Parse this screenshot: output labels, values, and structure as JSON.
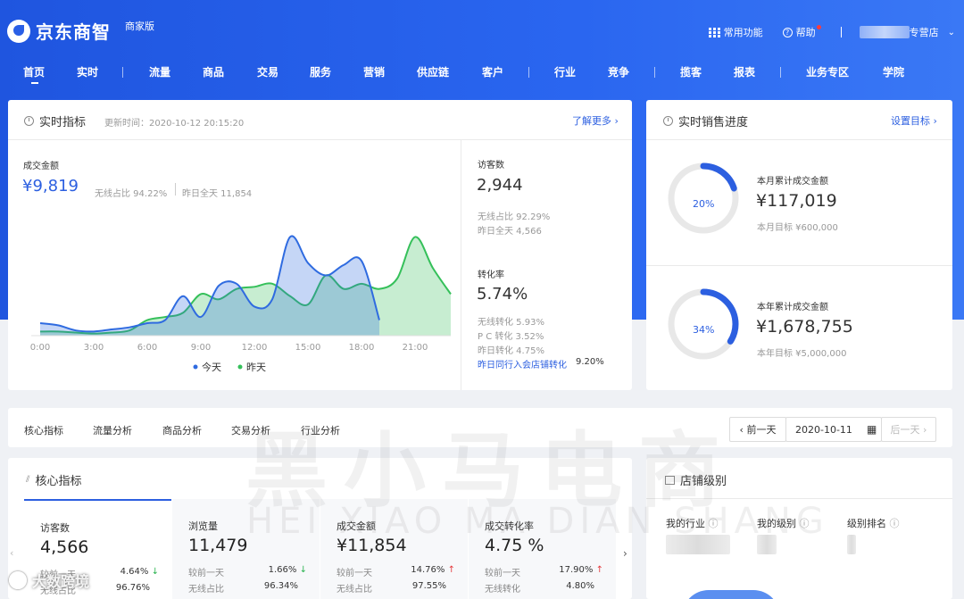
{
  "header": {
    "logo_text": "京东商智",
    "logo_sub": "商家版",
    "common_functions": "常用功能",
    "help": "帮助",
    "store_suffix": "专营店"
  },
  "nav": {
    "items": [
      "首页",
      "实时",
      "流量",
      "商品",
      "交易",
      "服务",
      "营销",
      "供应链",
      "客户",
      "行业",
      "竞争",
      "揽客",
      "报表",
      "业务专区",
      "学院"
    ]
  },
  "realtime": {
    "title": "实时指标",
    "update_time": "更新时间：2020-10-12 20:15:20",
    "learn_more": "了解更多 ›",
    "gmv_label": "成交金额",
    "gmv_value": "¥9,819",
    "wireless_share": "无线占比  94.22%",
    "yesterday_full": "昨日全天  11,854",
    "visitors_label": "访客数",
    "visitors_value": "2,944",
    "visitors_wireless": "无线占比    92.29%",
    "visitors_yesterday": "昨日全天    4,566",
    "conv_label": "转化率",
    "conv_value": "5.74%",
    "conv_wireless": "无线转化    5.93%",
    "conv_pc": "P C 转化    3.52%",
    "conv_yesterday": "昨日转化    4.75%",
    "conv_industry": "昨日同行入会店铺转化",
    "conv_industry_value": "9.20%",
    "legend_today": "今天",
    "legend_yesterday": "昨天"
  },
  "chart_data": {
    "type": "area",
    "x": [
      "0:00",
      "1:00",
      "2:00",
      "3:00",
      "4:00",
      "5:00",
      "6:00",
      "7:00",
      "8:00",
      "9:00",
      "10:00",
      "11:00",
      "12:00",
      "13:00",
      "14:00",
      "15:00",
      "16:00",
      "17:00",
      "18:00",
      "19:00",
      "20:00",
      "21:00",
      "22:00",
      "23:00"
    ],
    "x_ticks": [
      "0:00",
      "3:00",
      "6:00",
      "9:00",
      "12:00",
      "15:00",
      "18:00",
      "21:00"
    ],
    "series": [
      {
        "name": "今天",
        "color": "#2f6be0",
        "values": [
          12,
          10,
          5,
          4,
          6,
          8,
          12,
          15,
          38,
          18,
          48,
          50,
          28,
          35,
          95,
          70,
          58,
          68,
          72,
          15,
          null,
          null,
          null,
          null
        ]
      },
      {
        "name": "昨天",
        "color": "#35c05a",
        "values": [
          4,
          4,
          3,
          2,
          3,
          5,
          15,
          18,
          22,
          40,
          35,
          45,
          47,
          50,
          38,
          30,
          58,
          45,
          50,
          45,
          55,
          95,
          65,
          40
        ]
      }
    ],
    "ylim": [
      0,
      110
    ],
    "grid": false,
    "legend": "bottom-center"
  },
  "sales_progress": {
    "title": "实时销售进度",
    "set_target": "设置目标 ›",
    "month_pct": "20%",
    "month_fraction": 0.2,
    "month_label": "本月累计成交金额",
    "month_value": "¥117,019",
    "month_target": "本月目标  ¥600,000",
    "year_pct": "34%",
    "year_fraction": 0.34,
    "year_label": "本年累计成交金额",
    "year_value": "¥1,678,755",
    "year_target": "本年目标  ¥5,000,000"
  },
  "analysis_tabs": [
    "核心指标",
    "流量分析",
    "商品分析",
    "交易分析",
    "行业分析"
  ],
  "date_nav": {
    "prev": "‹ 前一天",
    "date": "2020-10-11",
    "next": "后一天 ›"
  },
  "core_metrics": {
    "title": "核心指标",
    "cards": [
      {
        "label": "访客数",
        "value": "4,566",
        "r1_label": "较前一天",
        "r1_value": "4.64%",
        "r1_dir": "down",
        "r2_label": "无线占比",
        "r2_value": "96.76%"
      },
      {
        "label": "浏览量",
        "value": "11,479",
        "r1_label": "较前一天",
        "r1_value": "1.66%",
        "r1_dir": "down",
        "r2_label": "无线占比",
        "r2_value": "96.34%"
      },
      {
        "label": "成交金额",
        "value": "¥11,854",
        "r1_label": "较前一天",
        "r1_value": "14.76%",
        "r1_dir": "up",
        "r2_label": "无线占比",
        "r2_value": "97.55%"
      },
      {
        "label": "成交转化率",
        "value": "4.75 %",
        "r1_label": "较前一天",
        "r1_value": "17.90%",
        "r1_dir": "up",
        "r2_label": "无线转化",
        "r2_value": "4.80%"
      }
    ]
  },
  "store_level": {
    "title": "店铺级别",
    "industry": "我的行业",
    "level": "我的级别",
    "rank": "级别排名"
  },
  "watermark": {
    "main": "黑小马电商",
    "pinyin": "HEI XIAO MA DIAN SHANG",
    "corner": "大数跨境"
  }
}
